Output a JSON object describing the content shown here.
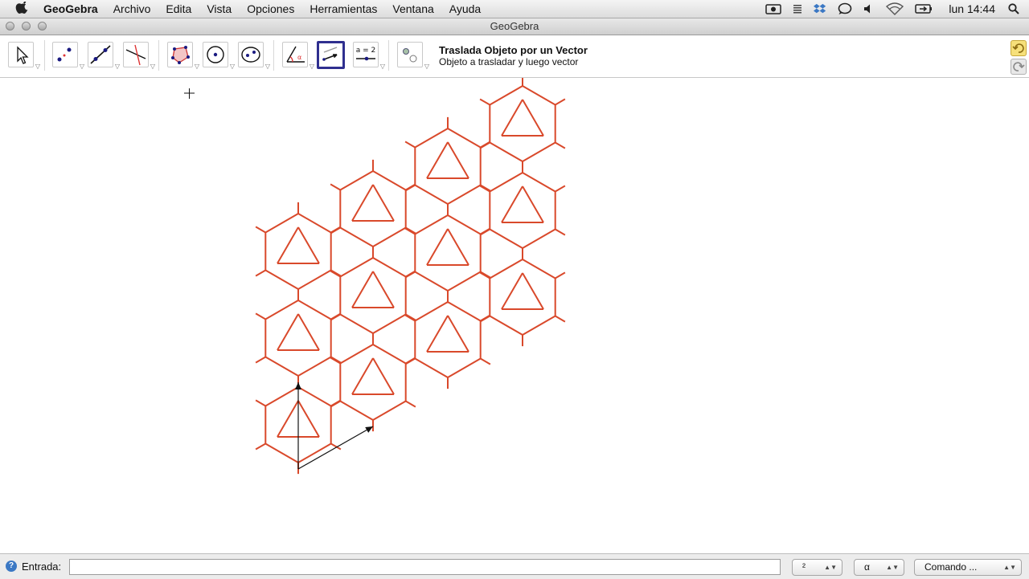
{
  "menubar": {
    "app_name": "GeoGebra",
    "menus": [
      "Archivo",
      "Edita",
      "Vista",
      "Opciones",
      "Herramientas",
      "Ventana",
      "Ayuda"
    ],
    "clock": "lun 14:44"
  },
  "window": {
    "title": "GeoGebra"
  },
  "toolbar": {
    "active_tool_title": "Traslada Objeto por un Vector",
    "active_tool_help": "Objeto a trasladar y luego vector",
    "slider_tool_label": "a = 2"
  },
  "input_bar": {
    "label": "Entrada:",
    "value": "",
    "symbol_combo": "²",
    "greek_combo": "α",
    "command_combo": "Comando ..."
  },
  "colors": {
    "pattern": "#d9492b",
    "vector": "#111111",
    "selected_tool_border": "#2f2f8f"
  }
}
